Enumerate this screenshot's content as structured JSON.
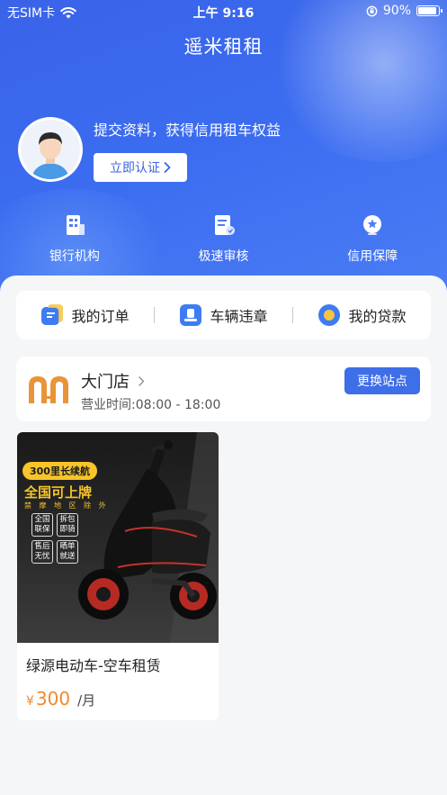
{
  "status_bar": {
    "carrier": "无SIM卡",
    "time": "上午 9:16",
    "battery_percent": "90%",
    "battery_level": 0.9
  },
  "header": {
    "title": "遥米租租"
  },
  "profile": {
    "promo_text": "提交资料，获得信用租车权益",
    "verify_button": "立即认证"
  },
  "features": [
    {
      "label": "银行机构",
      "icon": "bank-building-icon"
    },
    {
      "label": "极速审核",
      "icon": "document-review-icon"
    },
    {
      "label": "信用保障",
      "icon": "credit-shield-icon"
    }
  ],
  "quick_actions": [
    {
      "label": "我的订单",
      "icon": "order-icon"
    },
    {
      "label": "车辆违章",
      "icon": "violation-icon"
    },
    {
      "label": "我的贷款",
      "icon": "loan-icon"
    }
  ],
  "store": {
    "name": "大门店",
    "hours": "营业时间:08:00 - 18:00",
    "change_button": "更换站点"
  },
  "products": [
    {
      "title": "绿源电动车-空车租赁",
      "currency": "¥",
      "price": "300",
      "unit": "/月",
      "image_text": {
        "range": "300里长续航",
        "national": "全国可上牌",
        "sub": "禁 摩 地 区 除 外",
        "perks": [
          "全国联保",
          "拆包即骑",
          "售后无忧",
          "晒单就送"
        ]
      }
    }
  ],
  "colors": {
    "primary": "#3e6ee8",
    "price": "#f08a2c",
    "badge_yellow": "#f7c52a"
  }
}
